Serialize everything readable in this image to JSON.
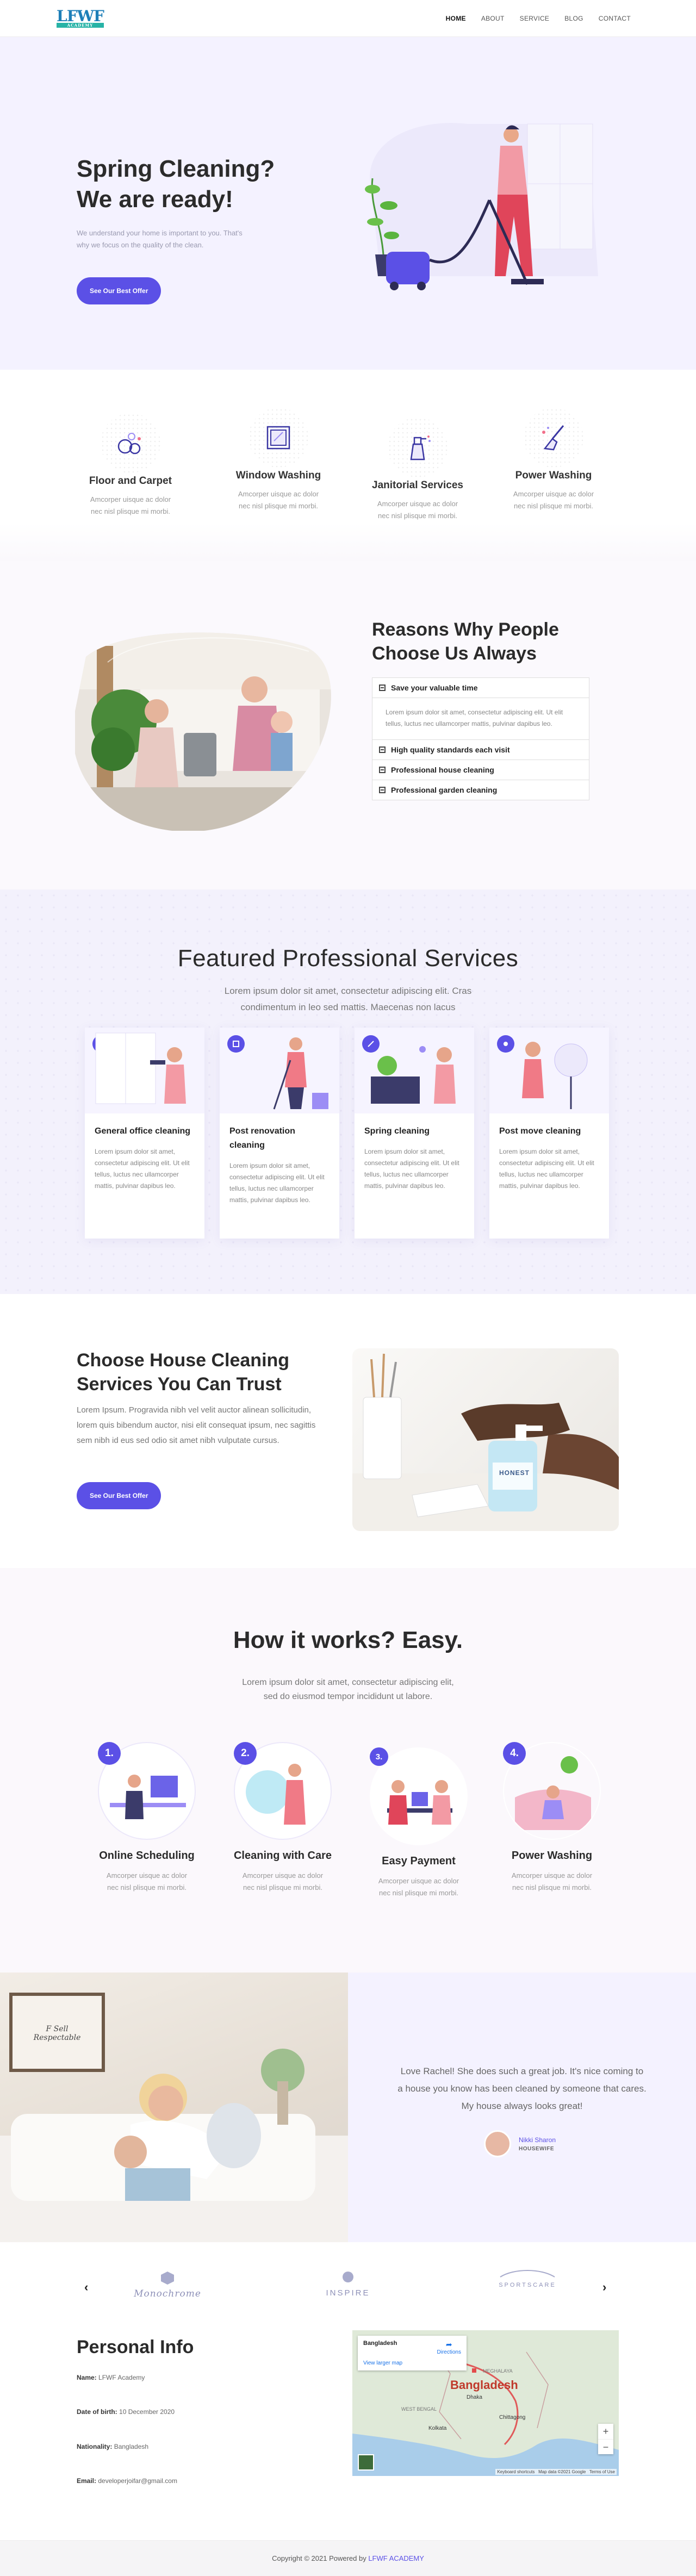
{
  "header": {
    "logo_text": "LFWF",
    "logo_sub": "ACADEMY",
    "nav": [
      "HOME",
      "ABOUT",
      "SERVICE",
      "BLOG",
      "CONTACT"
    ]
  },
  "hero": {
    "title_line1": "Spring Cleaning?",
    "title_line2": "We are ready!",
    "text": "We understand your home is important to you. That's why we focus on the quality of the clean.",
    "button": "See Our Best Offer"
  },
  "features": [
    {
      "title": "Floor and Carpet",
      "text": "Amcorper uisque ac dolor nec nisl plisque mi morbi.",
      "icon": "soap-bubbles-icon"
    },
    {
      "title": "Window Washing",
      "text": "Amcorper uisque ac dolor nec nisl plisque mi morbi.",
      "icon": "window-icon"
    },
    {
      "title": "Janitorial Services",
      "text": "Amcorper uisque ac dolor nec nisl plisque mi morbi.",
      "icon": "spray-bottle-icon"
    },
    {
      "title": "Power Washing",
      "text": "Amcorper uisque ac dolor nec nisl plisque mi morbi.",
      "icon": "broom-icon"
    }
  ],
  "reasons": {
    "title": "Reasons Why People Choose Us Always",
    "items": [
      {
        "title": "Save your valuable time",
        "body": "Lorem ipsum dolor sit amet, consectetur adipiscing elit. Ut elit tellus, luctus nec ullamcorper mattis, pulvinar dapibus leo."
      },
      {
        "title": "High quality standards each visit"
      },
      {
        "title": "Professional house cleaning"
      },
      {
        "title": "Professional garden cleaning"
      }
    ]
  },
  "services": {
    "title": "Featured Professional Services",
    "sub": "Lorem ipsum dolor sit amet, consectetur adipiscing elit. Cras condimentum in leo sed mattis. Maecenas non lacus",
    "cards": [
      {
        "title": "General office cleaning",
        "text": "Lorem ipsum dolor sit amet, consectetur adipiscing elit. Ut elit tellus, luctus nec ullamcorper mattis, pulvinar dapibus leo."
      },
      {
        "title": "Post renovation cleaning",
        "text": "Lorem ipsum dolor sit amet, consectetur adipiscing elit. Ut elit tellus, luctus nec ullamcorper mattis, pulvinar dapibus leo."
      },
      {
        "title": "Spring cleaning",
        "text": "Lorem ipsum dolor sit amet, consectetur adipiscing elit. Ut elit tellus, luctus nec ullamcorper mattis, pulvinar dapibus leo."
      },
      {
        "title": "Post move cleaning",
        "text": "Lorem ipsum dolor sit amet, consectetur adipiscing elit. Ut elit tellus, luctus nec ullamcorper mattis, pulvinar dapibus leo."
      }
    ]
  },
  "trust": {
    "title": "Choose House Cleaning Services You Can Trust",
    "text": "Lorem Ipsum. Progravida nibh vel velit auctor alinean sollicitudin, lorem quis bibendum auctor, nisi elit consequat ipsum, nec sagittis sem nibh id eus sed odio sit amet nibh vulputate cursus.",
    "button": "See Our Best Offer",
    "bottle_label": "HONEST"
  },
  "how": {
    "title": "How it works? Easy.",
    "sub": "Lorem ipsum dolor sit amet, consectetur adipiscing elit, sed do eiusmod tempor incididunt ut labore.",
    "steps": [
      {
        "num": "1.",
        "title": "Online Scheduling",
        "text": "Amcorper uisque ac dolor nec nisl plisque mi morbi."
      },
      {
        "num": "2.",
        "title": "Cleaning with Care",
        "text": "Amcorper uisque ac dolor nec nisl plisque mi morbi."
      },
      {
        "num": "3.",
        "title": "Easy Payment",
        "text": "Amcorper uisque ac dolor nec nisl plisque mi morbi."
      },
      {
        "num": "4.",
        "title": "Power Washing",
        "text": "Amcorper uisque ac dolor nec nisl plisque mi morbi."
      }
    ]
  },
  "testimonial": {
    "quote": "Love Rachel! She does such a great job. It's nice coming to a house you know has been cleaned by someone that cares. My house always looks great!",
    "name": "Nikki Sharon",
    "role": "HOUSEWIFE",
    "frame_text": "F Sell Respectable"
  },
  "brands": [
    "Monochrome",
    "INSPIRE",
    "SPORTSCARE"
  ],
  "personal": {
    "title": "Personal Info",
    "rows": [
      {
        "label": "Name:",
        "value": "LFWF Academy"
      },
      {
        "label": "Date of birth:",
        "value": "10 December 2020"
      },
      {
        "label": "Nationality:",
        "value": "Bangladesh"
      },
      {
        "label": "Email:",
        "value": "developerjoifar@gmail.com"
      }
    ]
  },
  "map": {
    "place": "Bangladesh",
    "directions": "Directions",
    "larger": "View larger map",
    "country": "Bangladesh",
    "cities": [
      "Chittagong",
      "Kolkata",
      "WEST BENGAL",
      "Dhaka",
      "MEGHALAYA"
    ],
    "credits": "Keyboard shortcuts   Map data ©2021 Google   Terms of Use"
  },
  "footer": {
    "text": "Copyright © 2021 Powered by ",
    "link": "LFWF ACADEMY"
  },
  "colors": {
    "accent": "#5b50e6",
    "hero_bg": "#f4f2ff"
  }
}
